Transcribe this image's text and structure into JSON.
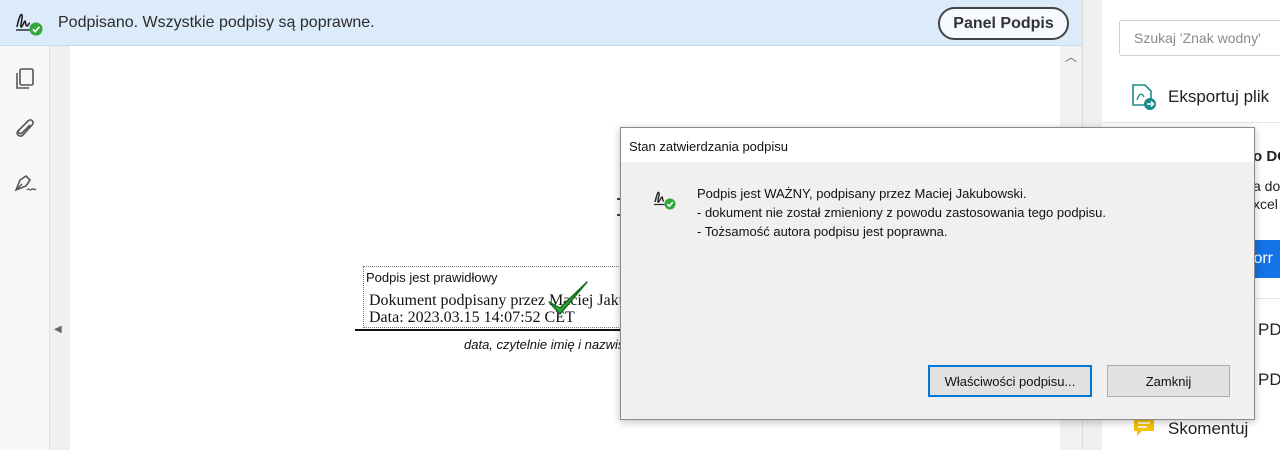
{
  "signature_bar": {
    "status_text": "Podpisano. Wszystkie podpisy są poprawne.",
    "panel_button": "Panel Podpis",
    "icon": "signature-valid-icon"
  },
  "left_toolbar": {
    "icons": [
      "pages-icon",
      "attachment-icon",
      "signature-pen-icon"
    ]
  },
  "document": {
    "signature_field": {
      "header": "Podpis jest prawidłowy",
      "line1": "Dokument podpisany przez Maciej Jakubowski",
      "line2": "Data: 2023.03.15 14:07:52 CET"
    },
    "caption": "data, czytelnie imię i nazwisko"
  },
  "right_pane": {
    "search_placeholder": "Szukaj 'Znak wodny'",
    "export_label": "Eksportuj plik",
    "fragments": {
      "do_pdf": "o DO",
      "a_do": "a do",
      "excel": "xcel",
      "blue_button": "forr",
      "pdf_1": "PDF",
      "pdf_2": "PDF"
    },
    "comment_label": "Skomentuj"
  },
  "dialog": {
    "title": "Stan zatwierdzania podpisu",
    "messages": [
      "Podpis jest WAŻNY, podpisany przez Maciej Jakubowski.",
      "- dokument nie został zmieniony z powodu zastosowania tego podpisu.",
      "- Tożsamość autora podpisu jest poprawna."
    ],
    "properties_button": "Właściwości podpisu...",
    "close_button": "Zamknij"
  },
  "colors": {
    "banner_bg": "#dcebf9",
    "valid_green": "#2fa83a",
    "accent_blue": "#1473e6",
    "dialog_bg": "#f0f0f0"
  }
}
